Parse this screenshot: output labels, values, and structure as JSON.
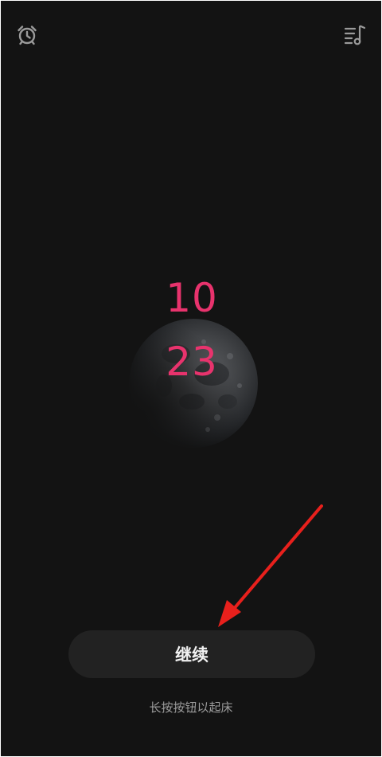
{
  "topbar": {
    "left_icon": "alarm-clock-icon",
    "right_icon": "music-playlist-icon"
  },
  "clock": {
    "hour": "10",
    "minute": "23",
    "color": "#e8336d"
  },
  "background_image": "moon",
  "actions": {
    "continue_label": "继续",
    "hint": "长按按钮以起床"
  },
  "annotation": {
    "arrow_color": "#e8201c"
  },
  "colors": {
    "background": "#131313",
    "button_bg": "#222222",
    "icon": "#9a9a9a"
  }
}
